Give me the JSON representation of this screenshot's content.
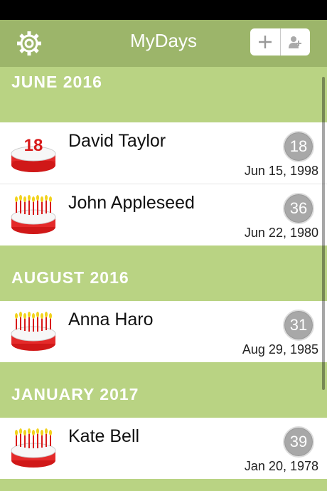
{
  "app": {
    "title": "MyDays"
  },
  "navbar": {
    "settings_icon": "gear-icon",
    "add_icon": "plus-icon",
    "contacts_icon": "add-contact-icon"
  },
  "colors": {
    "nav": "#9cb56a",
    "section": "#b9d383",
    "badge": "#a8a8a8"
  },
  "sections": [
    {
      "title": "JUNE 2016",
      "items": [
        {
          "name": "David Taylor",
          "age": "18",
          "date": "Jun 15, 1998",
          "icon": "cake-18-icon"
        },
        {
          "name": "John Appleseed",
          "age": "36",
          "date": "Jun 22, 1980",
          "icon": "cake-candles-icon"
        }
      ]
    },
    {
      "title": "AUGUST 2016",
      "items": [
        {
          "name": "Anna Haro",
          "age": "31",
          "date": "Aug 29, 1985",
          "icon": "cake-candles-icon"
        }
      ]
    },
    {
      "title": "JANUARY 2017",
      "items": [
        {
          "name": "Kate Bell",
          "age": "39",
          "date": "Jan 20, 1978",
          "icon": "cake-candles-icon"
        }
      ]
    }
  ]
}
